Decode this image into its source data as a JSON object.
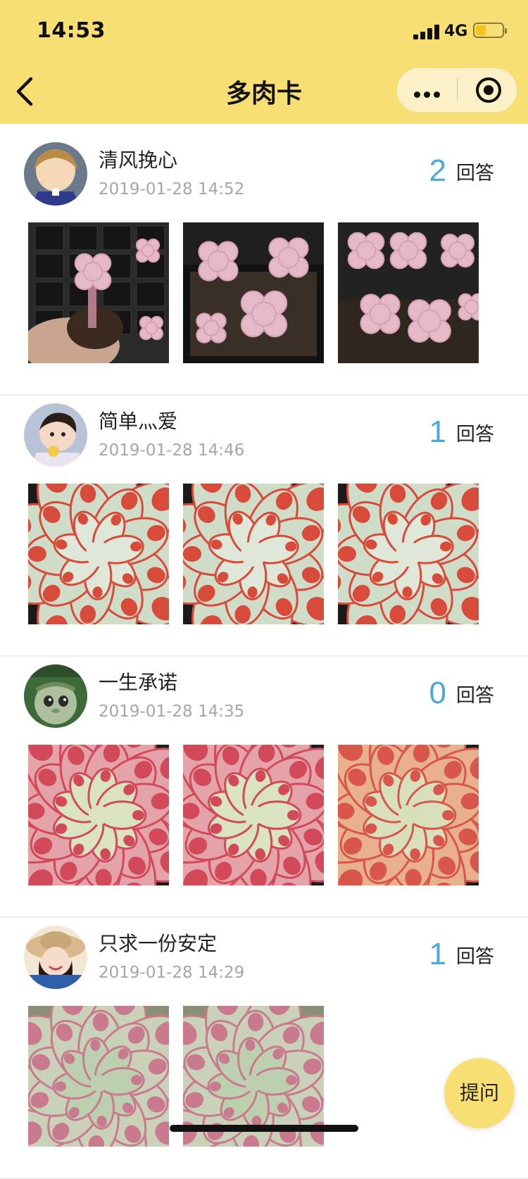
{
  "status_bar": {
    "time": "14:53",
    "network": "4G",
    "battery_level": 0.4
  },
  "nav": {
    "title": "多肉卡"
  },
  "answer_label": "回答",
  "posts": [
    {
      "username": "清风挽心",
      "time": "2019-01-28 14:52",
      "answer_count": "2",
      "avatar": "avatar-cartoon-boy",
      "photos": [
        "succulent-pink-cutting",
        "succulent-pink-tray",
        "succulent-pink-cluster"
      ]
    },
    {
      "username": "简单灬爱",
      "time": "2019-01-28 14:46",
      "answer_count": "1",
      "avatar": "avatar-toddler",
      "photos": [
        "succulent-red-rosette",
        "succulent-red-rosette",
        "succulent-red-rosette"
      ]
    },
    {
      "username": "一生承诺",
      "time": "2019-01-28 14:35",
      "answer_count": "0",
      "avatar": "avatar-green-monster",
      "photos": [
        "succulent-echeveria-pink",
        "succulent-echeveria-pink",
        "succulent-echeveria-orange"
      ]
    },
    {
      "username": "只求一份安定",
      "time": "2019-01-28 14:29",
      "answer_count": "1",
      "avatar": "avatar-woman-hat",
      "photos": [
        "succulent-green-pink",
        "succulent-green-pink"
      ]
    }
  ],
  "ask_button": {
    "label": "提问"
  },
  "colors": {
    "accent": "#f8df73",
    "answer_count": "#4aa8dc",
    "timestamp": "#a6a6a6"
  }
}
